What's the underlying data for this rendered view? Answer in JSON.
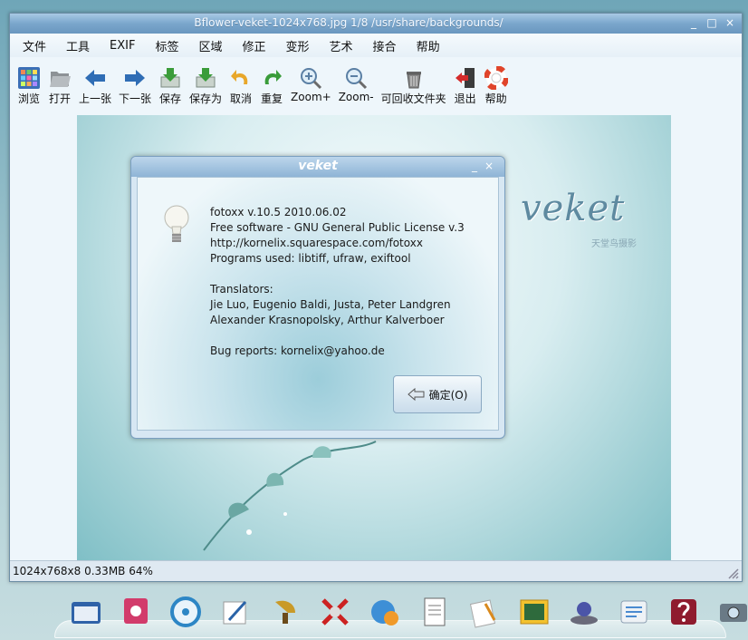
{
  "window": {
    "title": "Bflower-veket-1024x768.jpg  1/8  /usr/share/backgrounds/",
    "controls": [
      "_",
      "□",
      "×"
    ]
  },
  "menu": [
    "文件",
    "工具",
    "EXIF",
    "标签",
    "区域",
    "修正",
    "变形",
    "艺术",
    "接合",
    "帮助"
  ],
  "toolbar": [
    {
      "label": "浏览",
      "icon": "browse-grid-icon"
    },
    {
      "label": "打开",
      "icon": "open-folder-icon"
    },
    {
      "label": "上一张",
      "icon": "arrow-left-icon"
    },
    {
      "label": "下一张",
      "icon": "arrow-right-icon"
    },
    {
      "label": "保存",
      "icon": "save-icon"
    },
    {
      "label": "保存为",
      "icon": "save-as-icon"
    },
    {
      "label": "取消",
      "icon": "undo-icon"
    },
    {
      "label": "重复",
      "icon": "redo-icon"
    },
    {
      "label": "Zoom+",
      "icon": "zoom-in-icon"
    },
    {
      "label": "Zoom-",
      "icon": "zoom-out-icon"
    },
    {
      "label": "可回收文件夹",
      "icon": "trash-icon"
    },
    {
      "label": "退出",
      "icon": "exit-icon"
    },
    {
      "label": "帮助",
      "icon": "help-lifebuoy-icon"
    }
  ],
  "image": {
    "logo_text": "veket",
    "logo_sub": "天堂鸟摄影"
  },
  "status": "1024x768x8 0.33MB 64%",
  "dialog": {
    "title": "veket",
    "controls": [
      "_",
      "×"
    ],
    "lines": [
      "fotoxx v.10.5  2010.06.02",
      "Free software - GNU General Public License v.3",
      "http://kornelix.squarespace.com/fotoxx",
      "Programs used: libtiff, ufraw, exiftool",
      "",
      "Translators:",
      "Jie Luo, Eugenio Baldi, Justa, Peter Landgren",
      "Alexander Krasnopolsky, Arthur Kalverboer",
      "",
      "Bug reports: kornelix@yahoo.de"
    ],
    "ok_label": "确定(O)"
  },
  "dock": [
    "file-manager-icon",
    "photo-app-icon",
    "media-disc-icon",
    "text-editor-icon",
    "music-player-icon",
    "network-tool-icon",
    "web-browser-icon",
    "document-viewer-icon",
    "office-writer-icon",
    "image-viewer-icon",
    "system-monitor-icon",
    "settings-panel-icon",
    "help-icon",
    "camera-icon"
  ],
  "colors": {
    "titlebar": "#7aa6cc",
    "window_bg": "#eef6fb",
    "accent_green": "#3a9c3a",
    "accent_blue": "#2f6db5"
  }
}
